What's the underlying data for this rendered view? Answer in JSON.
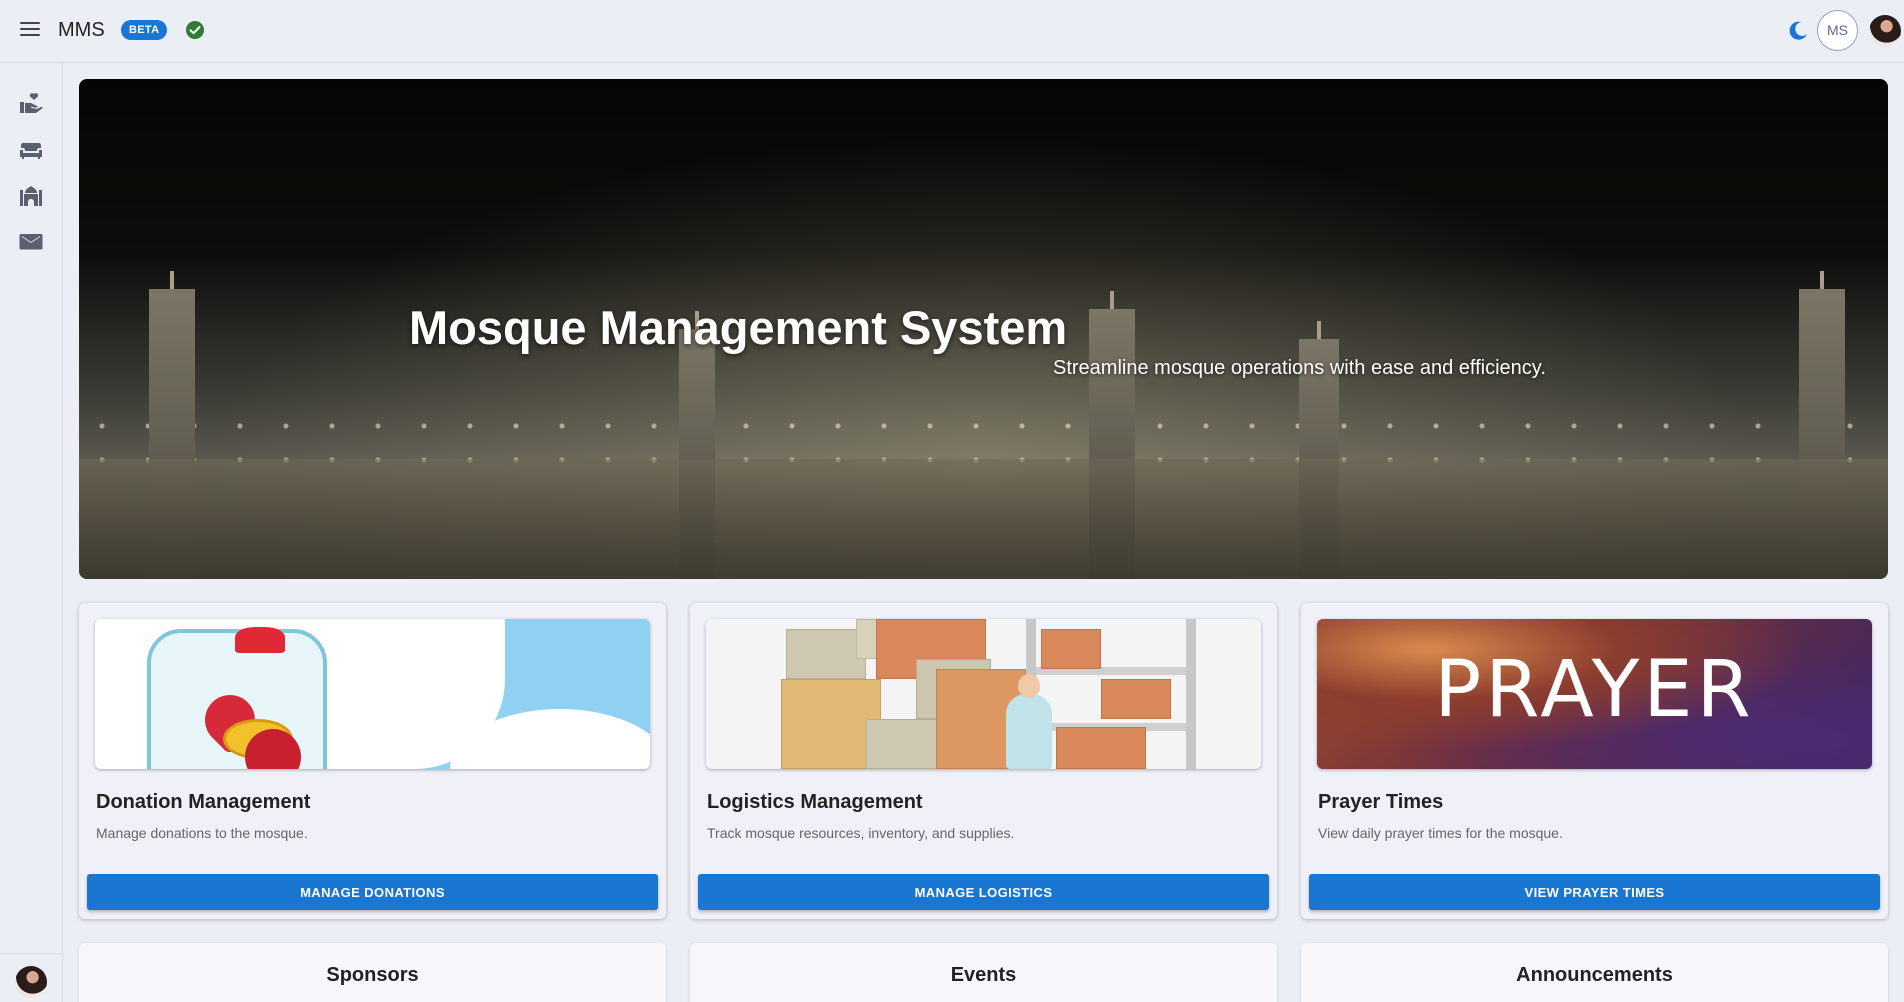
{
  "header": {
    "title": "MMS",
    "badge": "BETA",
    "user_initials": "MS"
  },
  "icons": {
    "menu": "menu-icon",
    "status": "check-circle-icon",
    "theme": "moon-icon",
    "sidebar": [
      "donation-hand-icon",
      "sofa-icon",
      "mosque-icon",
      "mail-icon"
    ]
  },
  "hero": {
    "title": "Mosque Management System",
    "subtitle": "Streamline mosque operations with ease and efficiency."
  },
  "cards": [
    {
      "title": "Donation Management",
      "description": "Manage donations to the mosque.",
      "button": "MANAGE DONATIONS"
    },
    {
      "title": "Logistics Management",
      "description": "Track mosque resources, inventory, and supplies.",
      "button": "MANAGE LOGISTICS"
    },
    {
      "title": "Prayer Times",
      "description": "View daily prayer times for the mosque.",
      "button": "VIEW PRAYER TIMES",
      "image_text": "PRAYER"
    }
  ],
  "cards_row2": [
    {
      "title": "Sponsors"
    },
    {
      "title": "Events"
    },
    {
      "title": "Announcements"
    }
  ],
  "colors": {
    "primary": "#1976d2",
    "background": "#eceef6",
    "status_ok": "#2e7d32"
  }
}
